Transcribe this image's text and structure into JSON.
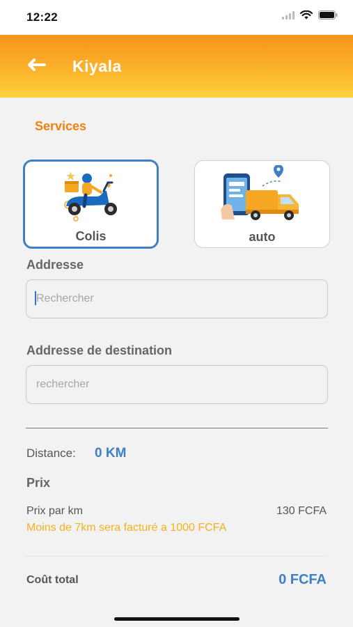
{
  "status_bar": {
    "time": "12:22",
    "icons": [
      "signal-icon",
      "wifi-icon",
      "battery-icon"
    ]
  },
  "header": {
    "title": "Kiyala",
    "back_icon": "arrow-left-icon"
  },
  "services": {
    "title": "Services",
    "items": [
      {
        "label": "Colis",
        "icon": "scooter-delivery-illustration",
        "selected": true
      },
      {
        "label": "auto",
        "icon": "truck-delivery-illustration",
        "selected": false
      }
    ]
  },
  "address": {
    "label": "Addresse",
    "placeholder": "Rechercher",
    "value": ""
  },
  "destination": {
    "label": "Addresse de destination",
    "placeholder": "rechercher",
    "value": ""
  },
  "distance": {
    "label": "Distance:",
    "value": "0 KM"
  },
  "price": {
    "title": "Prix",
    "per_km_label": "Prix par km",
    "per_km_value": "130 FCFA",
    "notice": "Moins de 7km sera facturé a 1000 FCFA"
  },
  "total": {
    "label": "Coût total",
    "value": "0 FCFA"
  },
  "colors": {
    "accent_orange": "#f7941d",
    "accent_yellow": "#fdd23d",
    "primary_blue": "#3f7fc4",
    "notice_yellow": "#f3b21b"
  }
}
